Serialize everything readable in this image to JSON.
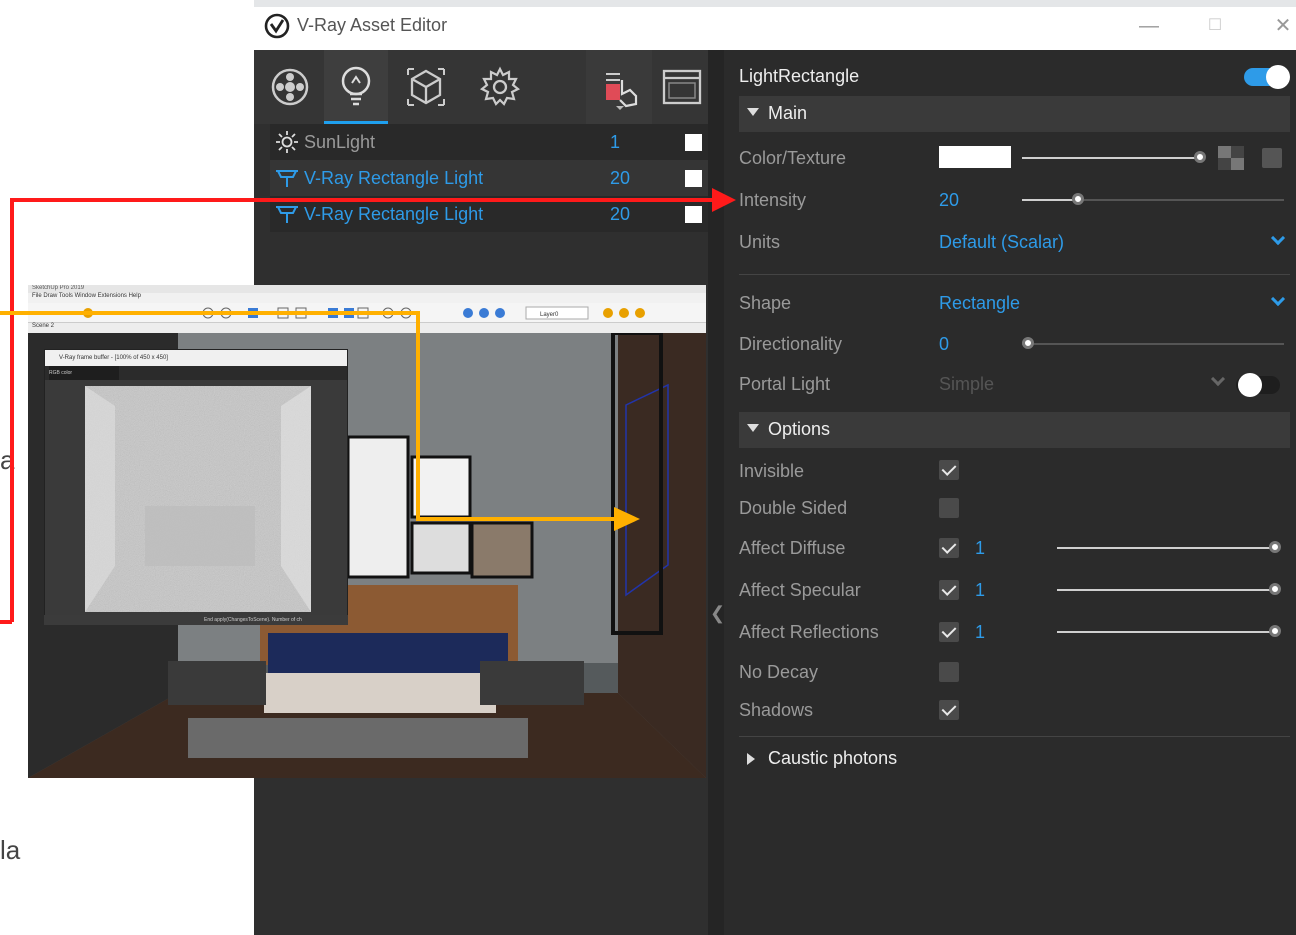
{
  "doc_fragments": {
    "frag1": "a",
    "frag2": "la"
  },
  "window": {
    "title": "V-Ray Asset Editor",
    "minimize": "—",
    "maximize": "☐",
    "close": "✕"
  },
  "toolbar": {
    "tabs": [
      {
        "name": "materials-icon"
      },
      {
        "name": "lights-icon"
      },
      {
        "name": "geometry-icon"
      },
      {
        "name": "settings-icon"
      },
      {
        "name": "render-tools-icon"
      },
      {
        "name": "frame-buffer-icon"
      }
    ]
  },
  "lights": [
    {
      "icon": "sun-icon",
      "name": "SunLight",
      "value": "1"
    },
    {
      "icon": "rect-light-icon",
      "name": "V-Ray Rectangle Light",
      "value": "20"
    },
    {
      "icon": "rect-light-icon",
      "name": "V-Ray Rectangle Light",
      "value": "20"
    }
  ],
  "props": {
    "asset_name": "LightRectangle",
    "main_section": "Main",
    "color_texture_label": "Color/Texture",
    "intensity_label": "Intensity",
    "intensity_value": "20",
    "intensity_fraction": 0.22,
    "units_label": "Units",
    "units_value": "Default (Scalar)",
    "shape_label": "Shape",
    "shape_value": "Rectangle",
    "directionality_label": "Directionality",
    "directionality_value": "0",
    "portal_label": "Portal Light",
    "portal_value": "Simple",
    "options_section": "Options",
    "invisible_label": "Invisible",
    "double_sided_label": "Double Sided",
    "affect_diffuse_label": "Affect Diffuse",
    "affect_diffuse_value": "1",
    "affect_specular_label": "Affect Specular",
    "affect_specular_value": "1",
    "affect_reflections_label": "Affect Reflections",
    "affect_reflections_value": "1",
    "no_decay_label": "No Decay",
    "shadows_label": "Shadows",
    "caustic_section": "Caustic photons"
  },
  "sketchup": {
    "title": "SketchUp Pro 2019",
    "menu": "File   Draw   Tools   Window   Extensions   Help",
    "scene_tab": "Scene 2",
    "layer": "Layer0"
  },
  "vfb": {
    "title": "V-Ray frame buffer - [100% of 450 x 450]",
    "channel": "RGB color",
    "status": "End apply(ChangesToScene). Number of ch"
  },
  "colors": {
    "accent": "#2e9be8",
    "red_arrow": "#ff1a1a",
    "orange_arrow": "#ffb000"
  }
}
